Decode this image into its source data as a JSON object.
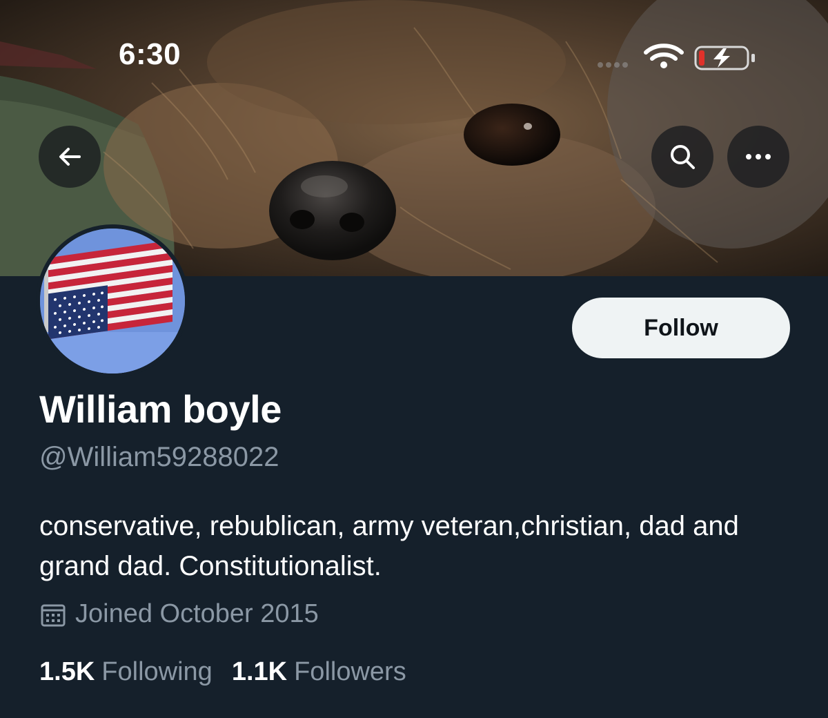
{
  "status_bar": {
    "time": "6:30",
    "icons": [
      "wifi-icon",
      "battery-charging-icon"
    ],
    "battery_color": "#e0312a"
  },
  "header": {
    "banner_description_icon": "dog-photo-banner",
    "back_icon": "arrow-left-icon",
    "search_icon": "search-icon",
    "more_icon": "more-horizontal-icon"
  },
  "profile": {
    "avatar_icon": "upside-down-us-flag-avatar",
    "follow_label": "Follow",
    "display_name": "William boyle",
    "handle": "@William59288022",
    "bio": "conservative, rebublican, army veteran,christian, dad and grand dad. Constitutionalist.",
    "joined_icon": "calendar-icon",
    "joined": "Joined October 2015",
    "following_count": "1.5K",
    "following_label": "Following",
    "followers_count": "1.1K",
    "followers_label": "Followers"
  },
  "colors": {
    "background": "#15202b",
    "primary_text": "#ffffff",
    "secondary_text": "#8b98a5",
    "follow_button_bg": "#eff3f4"
  }
}
